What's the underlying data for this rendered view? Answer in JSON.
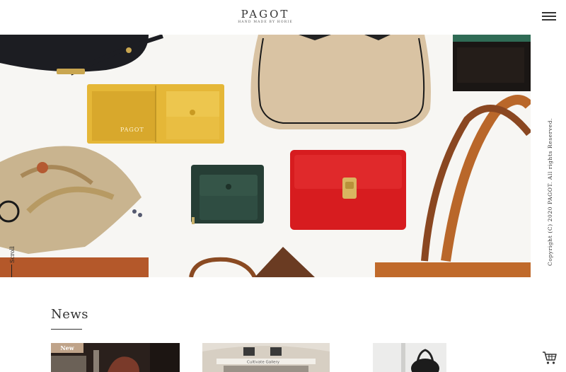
{
  "header": {
    "logo": "PAGOT",
    "tagline": "HAND MADE BY HORIE"
  },
  "hero": {
    "wallet_stamp": "PAGOT"
  },
  "side": {
    "scroll": "Scroll",
    "copyright": "Copyright (C) 2020 PAGOT. All rights Reserved."
  },
  "news": {
    "title": "News",
    "items": [
      {
        "badge": "New"
      },
      {
        "sign": "Cultivate Gallery"
      },
      {}
    ]
  },
  "icons": {
    "menu": "hamburger-menu-icon",
    "cart": "cart-icon"
  }
}
